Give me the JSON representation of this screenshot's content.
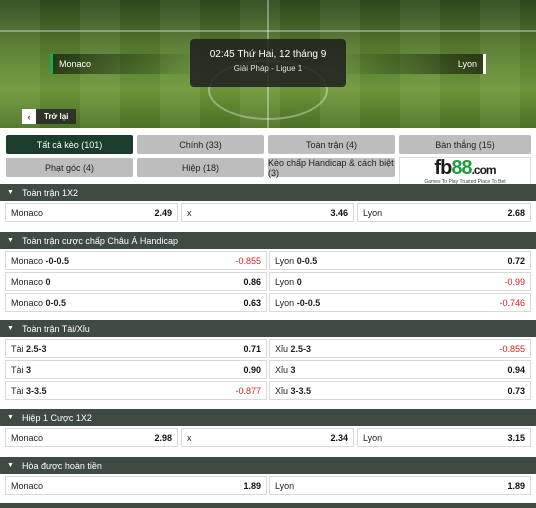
{
  "header": {
    "home_team": "Monaco",
    "away_team": "Lyon",
    "datetime": "02:45 Thứ Hai, 12 tháng 9",
    "league": "Giải Pháp - Ligue 1",
    "back_label": "Trở lại"
  },
  "tabs": [
    {
      "label": "Tất cả kèo (101)",
      "active": true
    },
    {
      "label": "Chính (33)",
      "active": false
    },
    {
      "label": "Toàn trận (4)",
      "active": false
    },
    {
      "label": "Bàn thắng (15)",
      "active": false
    },
    {
      "label": "Phạt góc (4)",
      "active": false
    },
    {
      "label": "Hiệp (18)",
      "active": false
    },
    {
      "label": "Kèo chấp Handicap & cách biệt (3)",
      "active": false
    }
  ],
  "ad": {
    "logo_fb": "fb",
    "logo_88": "88",
    "logo_com": ".com",
    "tagline": "Games To Play  Trusted Place To Bet"
  },
  "markets": {
    "m1x2": {
      "title": "Toàn trận 1X2",
      "row": [
        {
          "label": "Monaco",
          "line": "",
          "odd": "2.49"
        },
        {
          "label": "x",
          "line": "",
          "odd": "3.46"
        },
        {
          "label": "Lyon",
          "line": "",
          "odd": "2.68"
        }
      ]
    },
    "asian": {
      "title": "Toàn trận cược chấp Châu Á Handicap",
      "rows": [
        [
          {
            "label": "Monaco",
            "line": "-0-0.5",
            "odd": "-0.855"
          },
          {
            "label": "Lyon",
            "line": "0-0.5",
            "odd": "0.72"
          }
        ],
        [
          {
            "label": "Monaco",
            "line": "0",
            "odd": "0.86"
          },
          {
            "label": "Lyon",
            "line": "0",
            "odd": "-0.99"
          }
        ],
        [
          {
            "label": "Monaco",
            "line": "0-0.5",
            "odd": "0.63"
          },
          {
            "label": "Lyon",
            "line": "-0-0.5",
            "odd": "-0.746"
          }
        ]
      ]
    },
    "ou": {
      "title": "Toàn trận Tài/Xỉu",
      "rows": [
        [
          {
            "label": "Tài",
            "line": "2.5-3",
            "odd": "0.71"
          },
          {
            "label": "Xỉu",
            "line": "2.5-3",
            "odd": "-0.855"
          }
        ],
        [
          {
            "label": "Tài",
            "line": "3",
            "odd": "0.90"
          },
          {
            "label": "Xỉu",
            "line": "3",
            "odd": "0.94"
          }
        ],
        [
          {
            "label": "Tài",
            "line": "3-3.5",
            "odd": "-0.877"
          },
          {
            "label": "Xỉu",
            "line": "3-3.5",
            "odd": "0.73"
          }
        ]
      ]
    },
    "h1x2": {
      "title": "Hiệp 1 Cược 1X2",
      "row": [
        {
          "label": "Monaco",
          "line": "",
          "odd": "2.98"
        },
        {
          "label": "x",
          "line": "",
          "odd": "2.34"
        },
        {
          "label": "Lyon",
          "line": "",
          "odd": "3.15"
        }
      ]
    },
    "dnb": {
      "title": "Hòa được hoàn tiền",
      "row": [
        {
          "label": "Monaco",
          "line": "",
          "odd": "1.89"
        },
        {
          "label": "Lyon",
          "line": "",
          "odd": "1.89"
        }
      ]
    }
  },
  "colors": {
    "active_tab": "#1a3d2c",
    "section_header": "#3f4a43",
    "negative_odd": "#d21f1f",
    "brand_green": "#1d9e3a"
  }
}
